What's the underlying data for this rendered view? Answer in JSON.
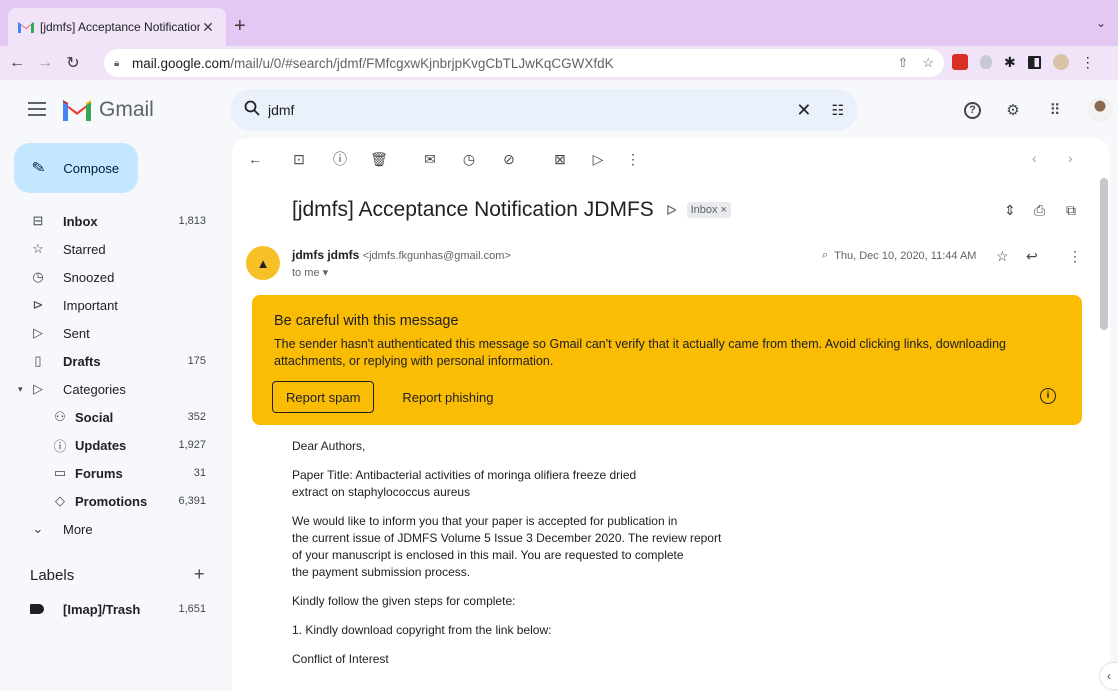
{
  "browser": {
    "tab_title": "[jdmfs] Acceptance Notification",
    "omnibox_host": "mail.google.com",
    "omnibox_path": "/mail/u/0/#search/jdmf/FMfcgxwKjnbrjpKvgCbTLJwKqCGWXfdK"
  },
  "gmail": {
    "brand": "Gmail",
    "search_query": "jdmf",
    "compose_label": "Compose",
    "nav": [
      {
        "label": "Inbox",
        "count": "1,813",
        "icon": "inbox-icon"
      },
      {
        "label": "Starred",
        "count": "",
        "icon": "star-icon"
      },
      {
        "label": "Snoozed",
        "count": "",
        "icon": "clock-icon"
      },
      {
        "label": "Important",
        "count": "",
        "icon": "important-icon"
      },
      {
        "label": "Sent",
        "count": "",
        "icon": "send-icon"
      },
      {
        "label": "Drafts",
        "count": "175",
        "icon": "draft-icon"
      },
      {
        "label": "Categories",
        "count": "",
        "icon": "label-icon"
      },
      {
        "label": "Social",
        "count": "352",
        "icon": "people-icon"
      },
      {
        "label": "Updates",
        "count": "1,927",
        "icon": "info-icon"
      },
      {
        "label": "Forums",
        "count": "31",
        "icon": "forum-icon"
      },
      {
        "label": "Promotions",
        "count": "6,391",
        "icon": "tag-icon"
      },
      {
        "label": "More",
        "count": "",
        "icon": "chevron-down-icon"
      }
    ],
    "labels_title": "Labels",
    "labels": [
      {
        "label": "[Imap]/Trash",
        "count": "1,651"
      }
    ]
  },
  "message": {
    "subject": "[jdmfs] Acceptance Notification JDMFS",
    "inbox_chip": "Inbox ×",
    "sender_name": "jdmfs jdmfs",
    "sender_email": "<jdmfs.fkgunhas@gmail.com>",
    "to_line": "to me ▾",
    "date": "Thu, Dec 10, 2020, 11:44 AM",
    "warning": {
      "title": "Be careful with this message",
      "body": "The sender hasn't authenticated this message so Gmail can't verify that it actually came from them. Avoid clicking links, downloading attachments, or replying with personal information.",
      "report_spam": "Report spam",
      "report_phishing": "Report phishing"
    },
    "body": [
      "Dear Authors,",
      "Paper Title: Antibacterial activities of moringa olifiera freeze dried\nextract on staphylococcus aureus",
      "We would like to inform you that your paper is accepted for publication in\nthe current issue of JDMFS Volume 5 Issue 3 December 2020. The review report\nof your manuscript is enclosed in this mail. You are requested to complete\nthe payment submission process.",
      "Kindly follow the given steps for complete:",
      "1. Kindly download copyright from the link below:",
      "Conflict of Interest"
    ]
  },
  "colors": {
    "warning_bg": "#fbbc04",
    "compose_bg": "#c2e7ff",
    "search_bg": "#eaf1fb",
    "tab_strip": "#e3c8f4"
  }
}
